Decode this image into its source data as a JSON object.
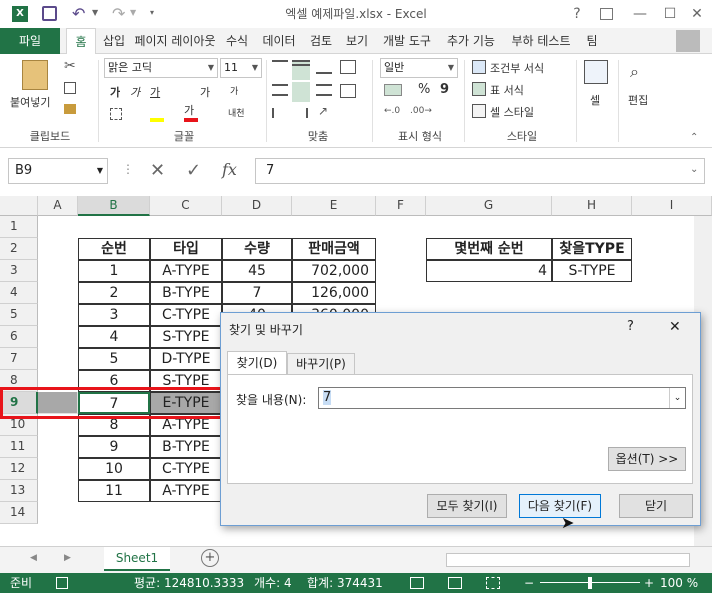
{
  "window": {
    "title": "엑셀 예제파일.xlsx - Excel",
    "help": "?",
    "restore_icon": "ribbon-display-icon",
    "minimize": "—",
    "maximize": "☐",
    "close": "✕"
  },
  "quick_access": {
    "save": "save-icon",
    "undo": "undo-icon",
    "redo": "redo-icon"
  },
  "tabs": [
    "파일",
    "홈",
    "삽입",
    "페이지 레이아웃",
    "수식",
    "데이터",
    "검토",
    "보기",
    "개발 도구",
    "추가 기능",
    "부하 테스트",
    "팀"
  ],
  "ribbon": {
    "clipboard": {
      "paste": "붙여넣기",
      "label": "클립보드"
    },
    "font": {
      "name": "맑은 고딕",
      "size": "11",
      "bold": "가",
      "italic": "가",
      "underline": "가",
      "grow": "가",
      "shrink": "가",
      "label": "글꼴",
      "phonetic": "내천"
    },
    "align": {
      "label": "맞춤"
    },
    "number": {
      "format": "일반",
      "percent": "%",
      "comma": "9",
      "label": "표시 형식"
    },
    "styles": {
      "conditional": "조건부 서식",
      "table": "표 서식",
      "cell": "셀 스타일",
      "label": "스타일"
    },
    "cells": {
      "label": "셀"
    },
    "editing": {
      "label": "편집"
    }
  },
  "formula_bar": {
    "name_box": "B9",
    "cancel": "✕",
    "enter": "✓",
    "fx": "fx",
    "value": "7"
  },
  "columns": [
    "A",
    "B",
    "C",
    "D",
    "E",
    "F",
    "G",
    "H",
    "I"
  ],
  "rows": [
    "1",
    "2",
    "3",
    "4",
    "5",
    "6",
    "7",
    "8",
    "9",
    "10",
    "11",
    "12",
    "13",
    "14"
  ],
  "table": {
    "headers": [
      "순번",
      "타입",
      "수량",
      "판매금액"
    ],
    "rows": [
      [
        "1",
        "A-TYPE",
        "45",
        "702,000"
      ],
      [
        "2",
        "B-TYPE",
        "7",
        "126,000"
      ],
      [
        "3",
        "C-TYPE",
        "40",
        "360,000"
      ],
      [
        "4",
        "S-TYPE",
        "",
        ""
      ],
      [
        "5",
        "D-TYPE",
        "",
        ""
      ],
      [
        "6",
        "S-TYPE",
        "",
        ""
      ],
      [
        "7",
        "E-TYPE",
        "",
        ""
      ],
      [
        "8",
        "A-TYPE",
        "",
        ""
      ],
      [
        "9",
        "B-TYPE",
        "",
        ""
      ],
      [
        "10",
        "C-TYPE",
        "",
        ""
      ],
      [
        "11",
        "A-TYPE",
        "",
        ""
      ]
    ]
  },
  "lookup": {
    "header1": "몇번째 순번",
    "header2": "찾을TYPE",
    "value1": "4",
    "value2": "S-TYPE"
  },
  "dialog": {
    "title": "찾기 및 바꾸기",
    "help": "?",
    "close": "✕",
    "tab_find": "찾기(D)",
    "tab_replace": "바꾸기(P)",
    "find_label": "찾을 내용(N):",
    "find_value": "7",
    "options": "옵션(T) >>",
    "find_all": "모두 찾기(I)",
    "find_next": "다음 찾기(F)",
    "close_button": "닫기"
  },
  "sheet": {
    "name": "Sheet1",
    "add": "+"
  },
  "status": {
    "ready": "준비",
    "average": "평균: 124810.3333",
    "count": "개수: 4",
    "sum": "합계: 374431",
    "zoom": "100 %",
    "zoom_minus": "−",
    "zoom_plus": "+"
  },
  "colors": {
    "excel_green": "#217346",
    "highlight_red": "#e8141a",
    "dialog_border": "#6d9ed3"
  }
}
